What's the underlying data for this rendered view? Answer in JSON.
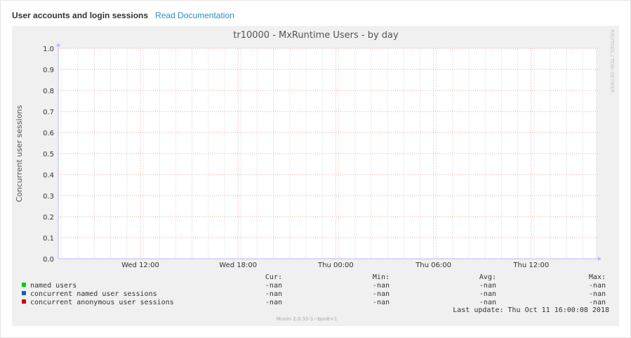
{
  "header": {
    "title": "User accounts and login sessions",
    "doc_link": "Read Documentation"
  },
  "watermark": "RRDTOOL / TOBI OETIKER",
  "footer_version": "Munin 2.0.33-1~bpo8+1",
  "legend": {
    "columns": [
      "Cur:",
      "Min:",
      "Avg:",
      "Max:"
    ],
    "rows": [
      {
        "label": "named users",
        "color": "#00cc00",
        "values": [
          "-nan",
          "-nan",
          "-nan",
          "-nan"
        ]
      },
      {
        "label": "concurrent named user sessions",
        "color": "#0066b3",
        "values": [
          "-nan",
          "-nan",
          "-nan",
          "-nan"
        ]
      },
      {
        "label": "concurrent anonymous user sessions",
        "color": "#cc0000",
        "values": [
          "-nan",
          "-nan",
          "-nan",
          "-nan"
        ]
      }
    ],
    "last_update": "Last update: Thu Oct 11 16:00:08 2018"
  },
  "chart_data": {
    "type": "line",
    "title": "tr10000 - MxRuntime Users - by day",
    "ylabel": "Concurrent user sessions",
    "xlabel": "",
    "ylim": [
      0,
      1
    ],
    "yticks": [
      "0.0",
      "0.1",
      "0.2",
      "0.3",
      "0.4",
      "0.5",
      "0.6",
      "0.7",
      "0.8",
      "0.9",
      "1.0"
    ],
    "xticks": [
      "Wed 12:00",
      "Wed 18:00",
      "Thu 00:00",
      "Thu 06:00",
      "Thu 12:00"
    ],
    "grid": true,
    "series": [
      {
        "name": "named users",
        "values": []
      },
      {
        "name": "concurrent named user sessions",
        "values": []
      },
      {
        "name": "concurrent anonymous user sessions",
        "values": []
      }
    ]
  }
}
